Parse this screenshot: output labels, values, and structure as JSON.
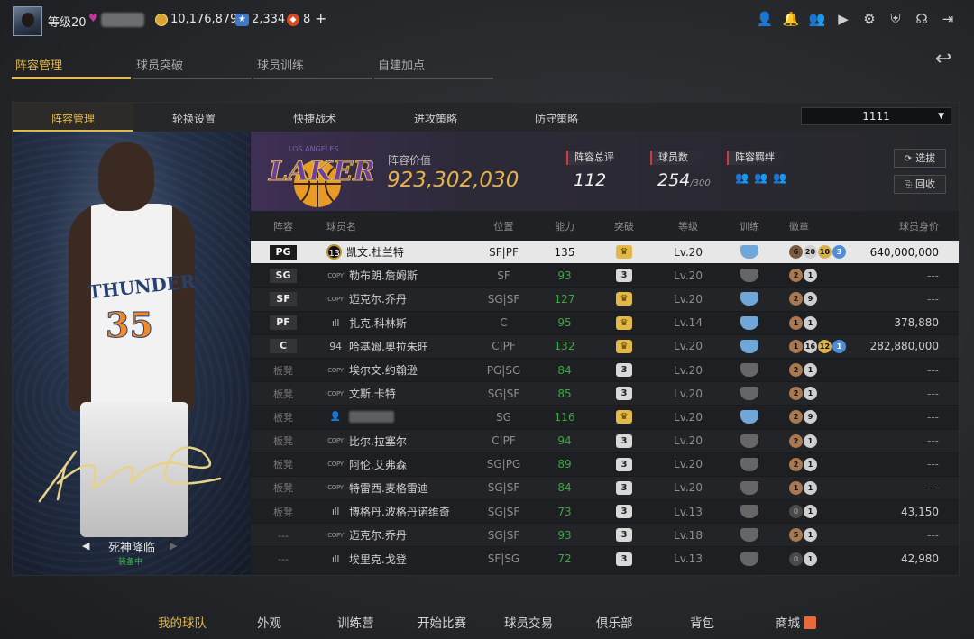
{
  "topbar": {
    "level": "等级20",
    "coins": "10,176,879",
    "stars": "2,334",
    "points": "8",
    "plus": "+",
    "icons": [
      "person-icon",
      "bell-icon",
      "friends-icon",
      "video-icon",
      "gear-icon",
      "shield-star-icon",
      "headset-icon",
      "exit-icon"
    ]
  },
  "main_tabs": [
    "阵容管理",
    "球员突破",
    "球员训练",
    "自建加点"
  ],
  "sub_tabs": [
    "阵容管理",
    "轮换设置",
    "快捷战术",
    "进攻策略",
    "防守策略"
  ],
  "lineup_select": "1111",
  "skin": {
    "name": "死神降临",
    "status": "装备中"
  },
  "team": {
    "value_label": "阵容价值",
    "value": "923,302,030",
    "rating_label": "阵容总评",
    "rating": "112",
    "count_label": "球员数",
    "count": "254",
    "count_max": "/300",
    "chem_label": "阵容羁绊",
    "btn_select": "选拔",
    "btn_recycle": "回收"
  },
  "columns": [
    "阵容",
    "球员名",
    "位置",
    "能力",
    "突破",
    "等级",
    "训练",
    "徽章",
    "球员身价"
  ],
  "rows": [
    {
      "slot": "PG",
      "prefix": "13",
      "name": "凯文.杜兰特",
      "pos": "SF|PF",
      "ovr": "135",
      "brk": "crown",
      "lv": "Lv.20",
      "trn": "blue",
      "badges": [
        [
          "rb",
          "6"
        ],
        [
          "sv",
          "20"
        ],
        [
          "gd",
          "10"
        ],
        [
          "bl",
          "3"
        ]
      ],
      "val": "640,000,000",
      "sel": true
    },
    {
      "slot": "SG",
      "prefix": "COPY",
      "name": "勒布朗.詹姆斯",
      "pos": "SF",
      "ovr": "93",
      "brk": "3",
      "lv": "Lv.20",
      "trn": "gray",
      "badges": [
        [
          "br",
          "2"
        ],
        [
          "sv",
          "1"
        ]
      ],
      "val": "---"
    },
    {
      "slot": "SF",
      "prefix": "COPY",
      "name": "迈克尔.乔丹",
      "pos": "SG|SF",
      "ovr": "127",
      "brk": "crown",
      "lv": "Lv.20",
      "trn": "blue",
      "badges": [
        [
          "br",
          "2"
        ],
        [
          "sv",
          "9"
        ]
      ],
      "val": "---"
    },
    {
      "slot": "PF",
      "prefix": "ıll",
      "name": "扎克.科林斯",
      "pos": "C",
      "ovr": "95",
      "brk": "crown",
      "lv": "Lv.14",
      "trn": "blue",
      "badges": [
        [
          "br",
          "1"
        ],
        [
          "sv",
          "1"
        ]
      ],
      "val": "378,880"
    },
    {
      "slot": "C",
      "prefix": "94",
      "name": "哈基姆.奥拉朱旺",
      "pos": "C|PF",
      "ovr": "132",
      "brk": "crown",
      "lv": "Lv.20",
      "trn": "blue",
      "badges": [
        [
          "br",
          "1"
        ],
        [
          "sv",
          "16"
        ],
        [
          "gd",
          "12"
        ],
        [
          "bl",
          "1"
        ]
      ],
      "val": "282,880,000"
    },
    {
      "slot": "板凳",
      "prefix": "COPY",
      "name": "埃尔文.约翰逊",
      "pos": "PG|SG",
      "ovr": "84",
      "brk": "3",
      "lv": "Lv.20",
      "trn": "gray",
      "badges": [
        [
          "br",
          "2"
        ],
        [
          "sv",
          "1"
        ]
      ],
      "val": "---"
    },
    {
      "slot": "板凳",
      "prefix": "COPY",
      "name": "文斯.卡特",
      "pos": "SG|SF",
      "ovr": "85",
      "brk": "3",
      "lv": "Lv.20",
      "trn": "gray",
      "badges": [
        [
          "br",
          "2"
        ],
        [
          "sv",
          "1"
        ]
      ],
      "val": "---"
    },
    {
      "slot": "板凳",
      "prefix": "person",
      "name": "",
      "pos": "SG",
      "ovr": "116",
      "brk": "crown",
      "lv": "Lv.20",
      "trn": "blue",
      "badges": [
        [
          "br",
          "2"
        ],
        [
          "sv",
          "9"
        ]
      ],
      "val": "---"
    },
    {
      "slot": "板凳",
      "prefix": "COPY",
      "name": "比尔.拉塞尔",
      "pos": "C|PF",
      "ovr": "94",
      "brk": "3",
      "lv": "Lv.20",
      "trn": "gray",
      "badges": [
        [
          "br",
          "2"
        ],
        [
          "sv",
          "1"
        ]
      ],
      "val": "---"
    },
    {
      "slot": "板凳",
      "prefix": "COPY",
      "name": "阿伦.艾弗森",
      "pos": "SG|PG",
      "ovr": "89",
      "brk": "3",
      "lv": "Lv.20",
      "trn": "gray",
      "badges": [
        [
          "br",
          "2"
        ],
        [
          "sv",
          "1"
        ]
      ],
      "val": "---"
    },
    {
      "slot": "板凳",
      "prefix": "COPY",
      "name": "特雷西.麦格雷迪",
      "pos": "SG|SF",
      "ovr": "84",
      "brk": "3",
      "lv": "Lv.20",
      "trn": "gray",
      "badges": [
        [
          "br",
          "1"
        ],
        [
          "sv",
          "1"
        ]
      ],
      "val": "---"
    },
    {
      "slot": "板凳",
      "prefix": "ıll",
      "name": "博格丹.波格丹诺维奇",
      "pos": "SG|SF",
      "ovr": "73",
      "brk": "3",
      "lv": "Lv.13",
      "trn": "gray",
      "badges": [
        [
          "dk",
          "0"
        ],
        [
          "sv",
          "1"
        ]
      ],
      "val": "43,150"
    },
    {
      "slot": "---",
      "prefix": "COPY",
      "name": "迈克尔.乔丹",
      "pos": "SG|SF",
      "ovr": "93",
      "brk": "3",
      "lv": "Lv.18",
      "trn": "gray",
      "badges": [
        [
          "br",
          "5"
        ],
        [
          "sv",
          "1"
        ]
      ],
      "val": "---"
    },
    {
      "slot": "---",
      "prefix": "ıll",
      "name": "埃里克.戈登",
      "pos": "SF|SG",
      "ovr": "72",
      "brk": "3",
      "lv": "Lv.13",
      "trn": "gray",
      "badges": [
        [
          "dk",
          "0"
        ],
        [
          "sv",
          "1"
        ]
      ],
      "val": "42,980"
    }
  ],
  "bottom_nav": [
    "我的球队",
    "外观",
    "训练营",
    "开始比赛",
    "球员交易",
    "俱乐部",
    "背包",
    "商城"
  ]
}
